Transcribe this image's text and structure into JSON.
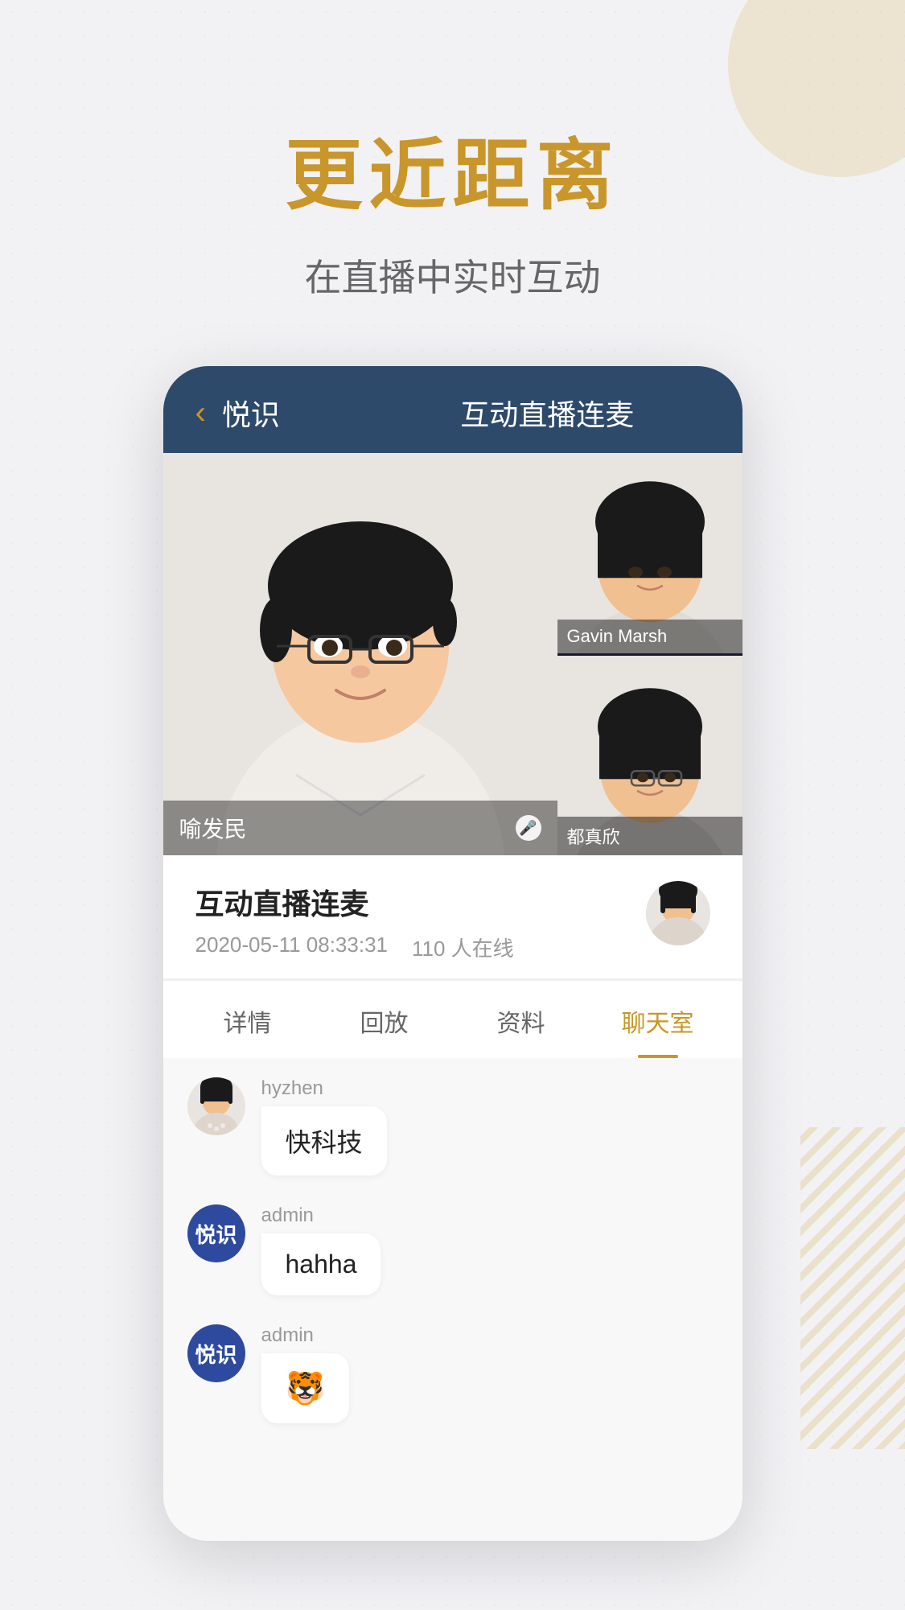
{
  "background": {
    "color": "#f2f2f5"
  },
  "hero": {
    "main_title": "更近距离",
    "subtitle": "在直播中实时互动"
  },
  "app": {
    "back_label": "‹",
    "name": "悦识",
    "header_title": "互动直播连麦",
    "stream": {
      "title": "互动直播连麦",
      "date": "2020-05-11 08:33:31",
      "online_count": "110 人在线"
    },
    "participants": [
      {
        "id": "main",
        "name": "喻发民",
        "has_mic": true
      },
      {
        "id": "top-right",
        "name": "Gavin Marsh"
      },
      {
        "id": "bottom-right",
        "name": "都真欣"
      }
    ],
    "tabs": [
      {
        "id": "detail",
        "label": "详情",
        "active": false
      },
      {
        "id": "replay",
        "label": "回放",
        "active": false
      },
      {
        "id": "materials",
        "label": "资料",
        "active": false
      },
      {
        "id": "chat",
        "label": "聊天室",
        "active": true
      }
    ],
    "chat_messages": [
      {
        "id": 1,
        "username": "hyzhen",
        "avatar_type": "photo",
        "message": "快科技"
      },
      {
        "id": 2,
        "username": "admin",
        "avatar_type": "logo",
        "avatar_text": "悦识",
        "message": "hahha"
      },
      {
        "id": 3,
        "username": "admin",
        "avatar_type": "logo",
        "avatar_text": "悦识",
        "message": "🐯"
      }
    ]
  }
}
